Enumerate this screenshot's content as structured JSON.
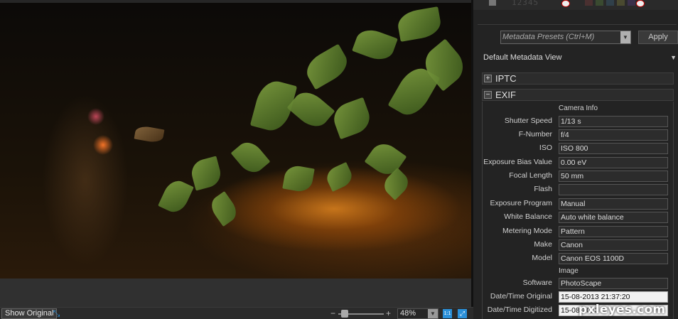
{
  "toolbar": {
    "rating_glyphs": "12345",
    "colors": [
      "#4a3030",
      "#3a4a30",
      "#30404a",
      "#4a4a30",
      "#3a304a"
    ]
  },
  "presets": {
    "placeholder": "Metadata Presets (Ctrl+M)",
    "apply_label": "Apply"
  },
  "view": {
    "selected": "Default Metadata View"
  },
  "sections": {
    "iptc": "IPTC",
    "exif": "EXIF"
  },
  "exif": {
    "camera_info_label": "Camera Info",
    "image_label": "Image",
    "rows": [
      {
        "label": "Shutter Speed",
        "value": "1/13 s"
      },
      {
        "label": "F-Number",
        "value": "f/4"
      },
      {
        "label": "ISO",
        "value": "ISO 800"
      },
      {
        "label": "Exposure Bias Value",
        "value": "0.00 eV"
      },
      {
        "label": "Focal Length",
        "value": "50 mm"
      },
      {
        "label": "Flash",
        "value": ""
      },
      {
        "label": "Exposure Program",
        "value": "Manual"
      },
      {
        "label": "White Balance",
        "value": "Auto white balance"
      },
      {
        "label": "Metering Mode",
        "value": "Pattern"
      },
      {
        "label": "Make",
        "value": "Canon"
      },
      {
        "label": "Model",
        "value": "Canon EOS 1100D"
      },
      {
        "label": "Software",
        "value": "PhotoScape"
      },
      {
        "label": "Date/Time Original",
        "value": "15-08-2013 21:37:20"
      },
      {
        "label": "Date/Time Digitized",
        "value": "15-08-2013"
      }
    ]
  },
  "bottombar": {
    "show_original": "Show Original",
    "zoom_value": "48%",
    "zoom_minus": "−",
    "zoom_plus": "+",
    "one_to_one": "1:1"
  },
  "watermark": "pxleyes.com"
}
